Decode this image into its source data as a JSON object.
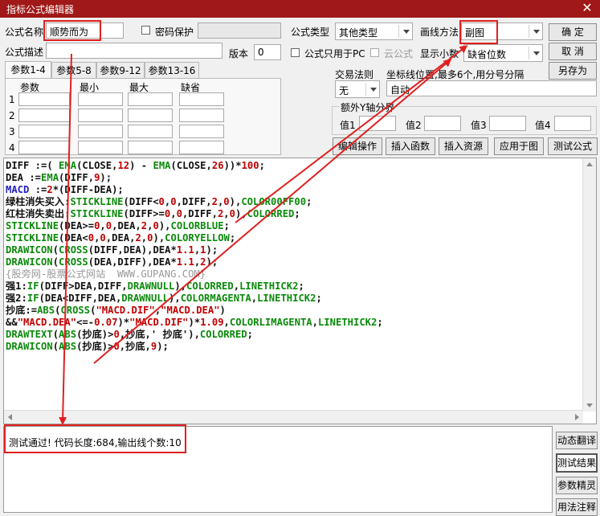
{
  "window": {
    "title": "指标公式编辑器",
    "close_glyph": "✕"
  },
  "form": {
    "name_label": "公式名称",
    "name_value": "顺势而为",
    "password_label": "密码保护",
    "desc_label": "公式描述",
    "version_label": "版本",
    "version_value": "0",
    "type_label": "公式类型",
    "type_value": "其他类型",
    "draw_label": "画线方法",
    "draw_value": "副图",
    "pc_only_label": "公式只用于PC",
    "cloud_label": "云公式",
    "decimals_label": "显示小数",
    "decimals_value": "缺省位数"
  },
  "buttons": {
    "ok": "确 定",
    "cancel": "取 消",
    "save_as": "另存为",
    "edit_op": "编辑操作",
    "insert_func": "插入函数",
    "insert_res": "插入资源",
    "apply_chart": "应用于图",
    "test_formula": "测试公式",
    "dyn_translate": "动态翻译",
    "test_result": "测试结果",
    "param_tuning": "参数精灵",
    "usage_note": "用法注释"
  },
  "tabs": [
    "参数1-4",
    "参数5-8",
    "参数9-12",
    "参数13-16"
  ],
  "params": {
    "headers": [
      "参数",
      "最小",
      "最大",
      "缺省"
    ],
    "rows": [
      "1",
      "2",
      "3",
      "4"
    ]
  },
  "trade": {
    "rule_label": "交易法则",
    "rule_value": "无",
    "coord_label": "坐标线位置,最多6个,用分号分隔",
    "coord_value": "自动",
    "extra_y_label": "额外Y轴分界",
    "v1": "值1",
    "v2": "值2",
    "v3": "值3",
    "v4": "值4"
  },
  "code_lines": [
    [
      [
        "k",
        "DIFF :=( "
      ],
      [
        "f",
        "EMA"
      ],
      [
        "k",
        "(CLOSE,"
      ],
      [
        "n",
        "12"
      ],
      [
        "k",
        ") - "
      ],
      [
        "f",
        "EMA"
      ],
      [
        "k",
        "(CLOSE,"
      ],
      [
        "n",
        "26"
      ],
      [
        "k",
        "))*"
      ],
      [
        "n",
        "100"
      ],
      [
        "k",
        ";"
      ]
    ],
    [
      [
        "k",
        "DEA :="
      ],
      [
        "f",
        "EMA"
      ],
      [
        "k",
        "(DIFF,"
      ],
      [
        "n",
        "9"
      ],
      [
        "k",
        ");"
      ]
    ],
    [
      [
        "b",
        "MACD"
      ],
      [
        "k",
        " :="
      ],
      [
        "n",
        "2"
      ],
      [
        "k",
        "*(DIFF-DEA);"
      ]
    ],
    [
      [
        "k",
        "绿柱消失买入:"
      ],
      [
        "f",
        "STICKLINE"
      ],
      [
        "k",
        "(DIFF<"
      ],
      [
        "n",
        "0"
      ],
      [
        "k",
        ","
      ],
      [
        "n",
        "0"
      ],
      [
        "k",
        ",DIFF,"
      ],
      [
        "n",
        "2"
      ],
      [
        "k",
        ","
      ],
      [
        "n",
        "0"
      ],
      [
        "k",
        "),"
      ],
      [
        "f",
        "COLOR00FF00"
      ],
      [
        "k",
        ";"
      ]
    ],
    [
      [
        "k",
        "红柱消失卖出:"
      ],
      [
        "f",
        "STICKLINE"
      ],
      [
        "k",
        "(DIFF>="
      ],
      [
        "n",
        "0"
      ],
      [
        "k",
        ","
      ],
      [
        "n",
        "0"
      ],
      [
        "k",
        ",DIFF,"
      ],
      [
        "n",
        "2"
      ],
      [
        "k",
        ","
      ],
      [
        "n",
        "0"
      ],
      [
        "k",
        "),"
      ],
      [
        "f",
        "COLORRED"
      ],
      [
        "k",
        ";"
      ]
    ],
    [
      [
        "f",
        "STICKLINE"
      ],
      [
        "k",
        "(DEA>="
      ],
      [
        "n",
        "0"
      ],
      [
        "k",
        ","
      ],
      [
        "n",
        "0"
      ],
      [
        "k",
        ",DEA,"
      ],
      [
        "n",
        "2"
      ],
      [
        "k",
        ","
      ],
      [
        "n",
        "0"
      ],
      [
        "k",
        "),"
      ],
      [
        "f",
        "COLORBLUE"
      ],
      [
        "k",
        ";"
      ]
    ],
    [
      [
        "f",
        "STICKLINE"
      ],
      [
        "k",
        "(DEA<"
      ],
      [
        "n",
        "0"
      ],
      [
        "k",
        ","
      ],
      [
        "n",
        "0"
      ],
      [
        "k",
        ",DEA,"
      ],
      [
        "n",
        "2"
      ],
      [
        "k",
        ","
      ],
      [
        "n",
        "0"
      ],
      [
        "k",
        "),"
      ],
      [
        "f",
        "COLORYELLOW"
      ],
      [
        "k",
        ";"
      ]
    ],
    [
      [
        "f",
        "DRAWICON"
      ],
      [
        "k",
        "("
      ],
      [
        "f",
        "CROSS"
      ],
      [
        "k",
        "(DIFF,DEA),DEA*"
      ],
      [
        "n",
        "1.1"
      ],
      [
        "k",
        ","
      ],
      [
        "n",
        "1"
      ],
      [
        "k",
        ");"
      ]
    ],
    [
      [
        "f",
        "DRAWICON"
      ],
      [
        "k",
        "("
      ],
      [
        "f",
        "CROSS"
      ],
      [
        "k",
        "(DEA,DIFF),DEA*"
      ],
      [
        "n",
        "1.1"
      ],
      [
        "k",
        ","
      ],
      [
        "n",
        "2"
      ],
      [
        "k",
        ");"
      ]
    ],
    [
      [
        "g",
        "{股旁网-股票公式网站  WWW.GUPANG.COM}"
      ]
    ],
    [
      [
        "k",
        "强1:"
      ],
      [
        "f",
        "IF"
      ],
      [
        "k",
        "(DIFF>DEA,DIFF,"
      ],
      [
        "f",
        "DRAWNULL"
      ],
      [
        "k",
        "),"
      ],
      [
        "f",
        "COLORRED"
      ],
      [
        "k",
        ","
      ],
      [
        "f",
        "LINETHICK2"
      ],
      [
        "k",
        ";"
      ]
    ],
    [
      [
        "k",
        "强2:"
      ],
      [
        "f",
        "IF"
      ],
      [
        "k",
        "(DEA<DIFF,DEA,"
      ],
      [
        "f",
        "DRAWNULL"
      ],
      [
        "k",
        "),"
      ],
      [
        "f",
        "COLORMAGENTA"
      ],
      [
        "k",
        ","
      ],
      [
        "f",
        "LINETHICK2"
      ],
      [
        "k",
        ";"
      ]
    ],
    [
      [
        "k",
        "抄底:="
      ],
      [
        "f",
        "ABS"
      ],
      [
        "k",
        "("
      ],
      [
        "f",
        "CROSS"
      ],
      [
        "k",
        "("
      ],
      [
        "s",
        "\"MACD.DIF\""
      ],
      [
        "k",
        ","
      ],
      [
        "s",
        "\"MACD.DEA\""
      ],
      [
        "k",
        ")"
      ]
    ],
    [
      [
        "k",
        "&&"
      ],
      [
        "s",
        "\"MACD.DEA\""
      ],
      [
        "k",
        "<=-"
      ],
      [
        "n",
        "0.07"
      ],
      [
        "k",
        ")*"
      ],
      [
        "s",
        "\"MACD.DIF\""
      ],
      [
        "k",
        ")*"
      ],
      [
        "n",
        "1.09"
      ],
      [
        "k",
        ","
      ],
      [
        "f",
        "COLORLIMAGENTA"
      ],
      [
        "k",
        ","
      ],
      [
        "f",
        "LINETHICK2"
      ],
      [
        "k",
        ";"
      ]
    ],
    [
      [
        "f",
        "DRAWTEXT"
      ],
      [
        "k",
        "("
      ],
      [
        "f",
        "ABS"
      ],
      [
        "k",
        "(抄底)>"
      ],
      [
        "n",
        "0"
      ],
      [
        "k",
        ",抄底,' 抄底'),"
      ],
      [
        "f",
        "COLORRED"
      ],
      [
        "k",
        ";"
      ]
    ],
    [
      [
        "f",
        "DRAWICON"
      ],
      [
        "k",
        "("
      ],
      [
        "f",
        "ABS"
      ],
      [
        "k",
        "(抄底)>"
      ],
      [
        "n",
        "0"
      ],
      [
        "k",
        ",抄底,"
      ],
      [
        "n",
        "9"
      ],
      [
        "k",
        ");"
      ]
    ]
  ],
  "status": {
    "message": "测试通过! 代码长度:684,输出线个数:10"
  },
  "colors": {
    "title_bar": "#a01818",
    "annotation": "#e02020",
    "function": "#0a8a0a",
    "number": "#c00000"
  },
  "icons": [
    "close-icon",
    "dropdown-arrow-icon",
    "checkbox-icon",
    "scroll-up-icon",
    "scroll-down-icon",
    "scroll-left-icon",
    "scroll-right-icon",
    "annotation-arrow-icon"
  ]
}
